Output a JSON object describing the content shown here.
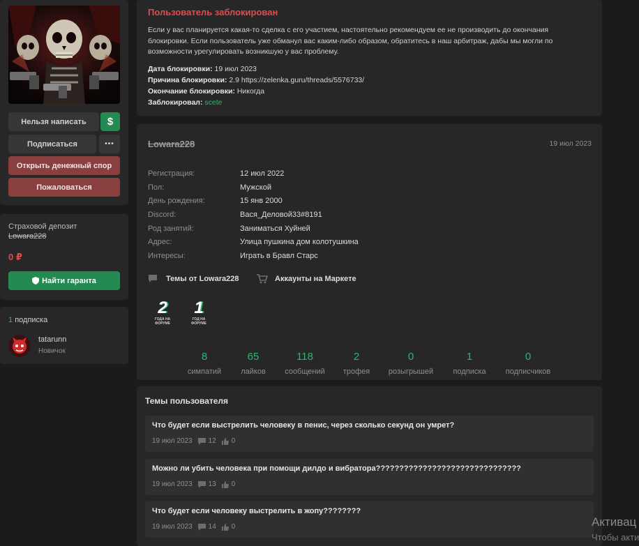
{
  "left": {
    "buttons": {
      "cant_write": "Нельзя написать",
      "dollar": "$",
      "subscribe": "Подписаться",
      "more": "•••",
      "open_dispute": "Открыть денежный спор",
      "complain": "Пожаловаться"
    },
    "deposit": {
      "title": "Страховой депозит",
      "username": "Lowara228",
      "amount": "0 ₽",
      "guarantor_button": "Найти гаранта"
    },
    "subscriptions": {
      "count": "1",
      "label": "подписка",
      "user_name": "tatarunn",
      "user_rank": "Новичок"
    }
  },
  "ban": {
    "title": "Пользователь заблокирован",
    "text": "Если у вас планируется какая-то сделка с его участием, настоятельно рекомендуем ее не производить до окончания блокировки. Если пользователь уже обманул вас каким-либо образом, обратитесь в наш арбитраж, дабы мы могли по возможности урегулировать возникшую у вас проблему.",
    "date_label": "Дата блокировки:",
    "date_value": "19 июл 2023",
    "reason_label": "Причина блокировки:",
    "reason_value": "2.9 https://zelenka.guru/threads/5576733/",
    "end_label": "Окончание блокировки:",
    "end_value": "Никогда",
    "by_label": "Заблокировал:",
    "by_value": "scete"
  },
  "profile": {
    "username": "Lowara228",
    "date": "19 июл 2023",
    "rows": [
      {
        "label": "Регистрация:",
        "value": "12 июл 2022"
      },
      {
        "label": "Пол:",
        "value": "Мужской"
      },
      {
        "label": "День рождения:",
        "value": "15 янв 2000"
      },
      {
        "label": "Discord:",
        "value": "Вася_Деловой33#8191"
      },
      {
        "label": "Род занятий:",
        "value": "Заниматься Хуйней"
      },
      {
        "label": "Адрес:",
        "value": "Улица пушкина дом колотушкина"
      },
      {
        "label": "Интересы:",
        "value": "Играть в Бравл Старс"
      }
    ],
    "links": {
      "threads": "Темы от Lowara228",
      "market": "Аккаунты на Маркете"
    },
    "badges": [
      {
        "number": "2",
        "caption": "ГОДА НА ФОРУМЕ"
      },
      {
        "number": "1",
        "caption": "ГОД НА ФОРУМЕ"
      }
    ],
    "stats": [
      {
        "num": "8",
        "cap": "симпатий"
      },
      {
        "num": "65",
        "cap": "лайков"
      },
      {
        "num": "118",
        "cap": "сообщений"
      },
      {
        "num": "2",
        "cap": "трофея"
      },
      {
        "num": "0",
        "cap": "розыгрышей"
      },
      {
        "num": "1",
        "cap": "подписка"
      },
      {
        "num": "0",
        "cap": "подписчиков"
      }
    ]
  },
  "threads": {
    "heading": "Темы пользователя",
    "items": [
      {
        "title": "Что будет если выстрелить человеку в пенис, через сколько секунд он умрет?",
        "date": "19 июл 2023",
        "replies": "12",
        "likes": "0"
      },
      {
        "title": "Можно ли убить человека при помощи дилдо и вибратора???????????????????????????????",
        "date": "19 июл 2023",
        "replies": "13",
        "likes": "0"
      },
      {
        "title": "Что будет если человеку выстрелить в жопу????????",
        "date": "19 июл 2023",
        "replies": "14",
        "likes": "0"
      }
    ]
  },
  "watermark": {
    "line1": "Активац",
    "line2": "Чтобы акти"
  }
}
